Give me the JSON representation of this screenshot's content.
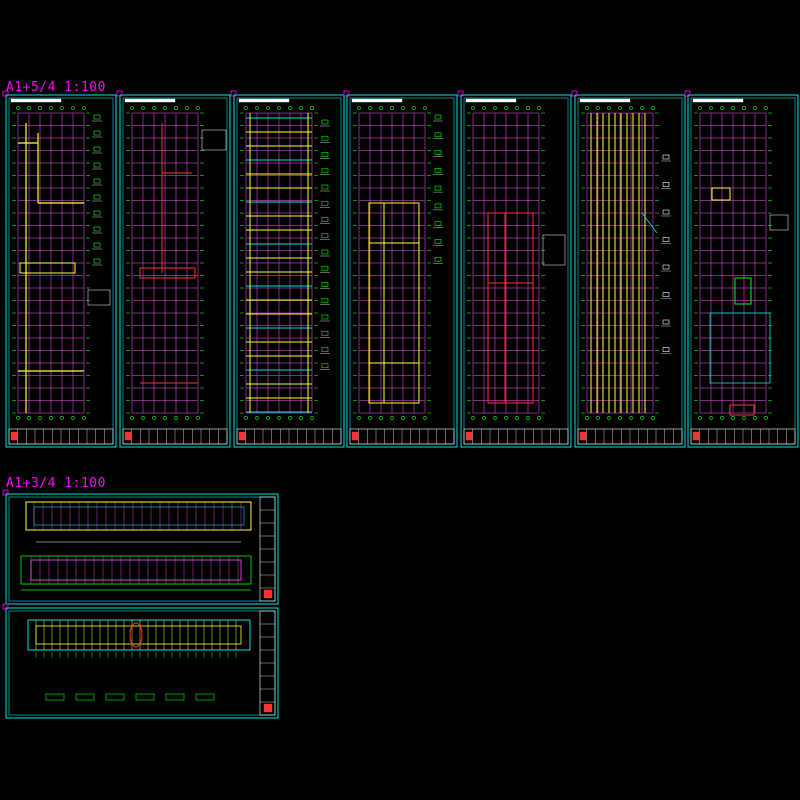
{
  "groups": [
    {
      "label": "A1+5/4 1:100"
    },
    {
      "label": "A1+3/4 1:100"
    }
  ],
  "colors": {
    "background": "#000000",
    "frame": "#00e0e0",
    "grid": "#ff55ff",
    "axis": "#00ff00",
    "beam": "#ffff33",
    "red": "#ff3333",
    "white": "#ffffff",
    "label": "#ff00ff"
  },
  "sheets_top": [
    {
      "kind": "plan-yellow-magenta"
    },
    {
      "kind": "plan-red"
    },
    {
      "kind": "plan-yellow-cyan-beams"
    },
    {
      "kind": "plan-yellow-partial"
    },
    {
      "kind": "plan-red-partial"
    },
    {
      "kind": "plan-yellow-vertical-strips"
    },
    {
      "kind": "plan-details-red"
    }
  ],
  "sheets_bottom": [
    {
      "kind": "elevation-two"
    },
    {
      "kind": "elevation-roof"
    }
  ]
}
